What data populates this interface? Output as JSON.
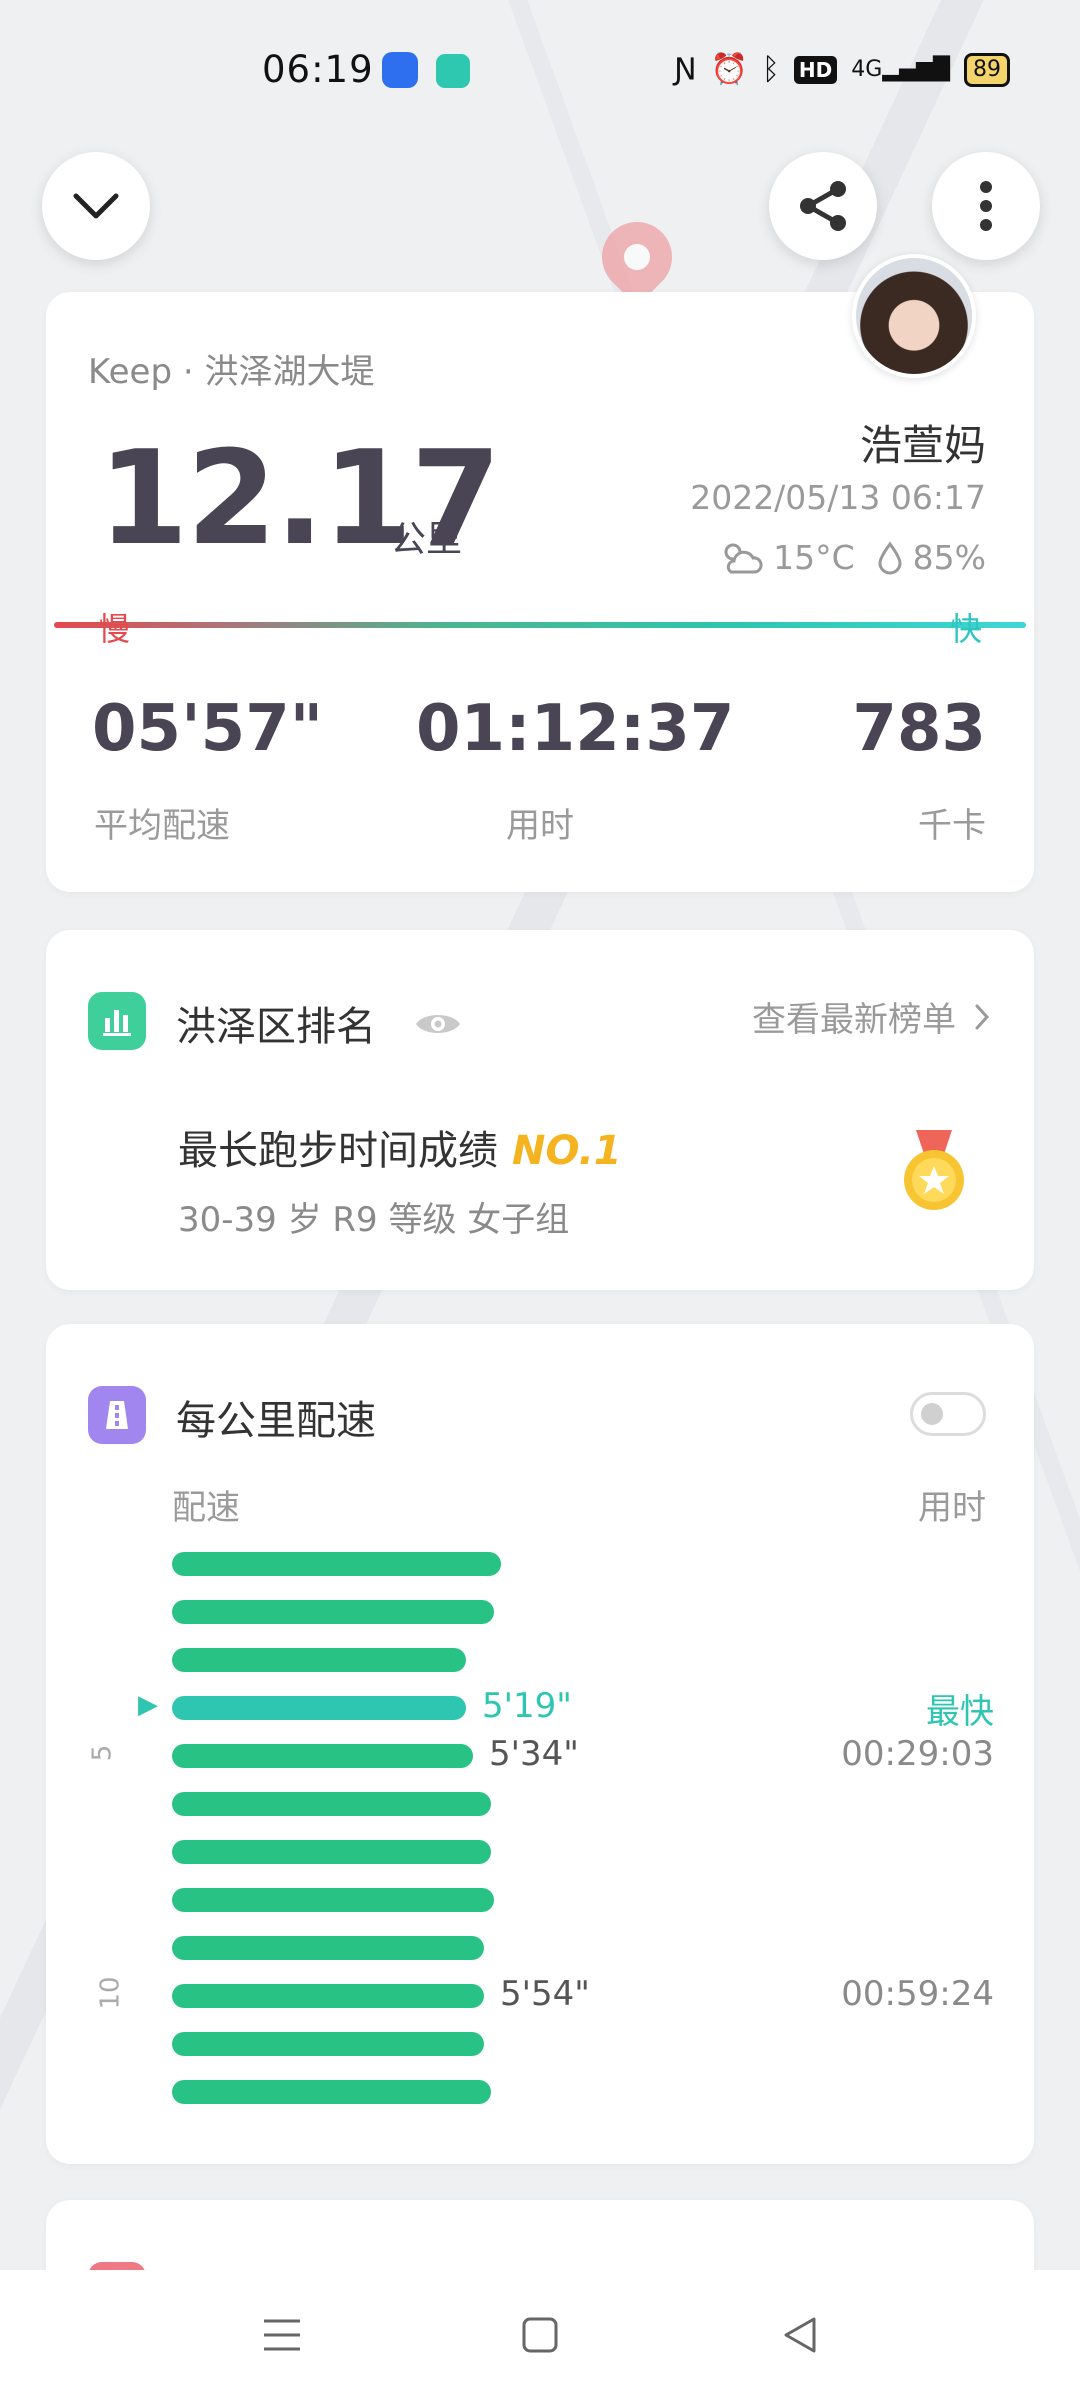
{
  "status_bar": {
    "time": "06:19",
    "battery": "89",
    "network": "4G",
    "hd": "HD"
  },
  "summary": {
    "source": "Keep · 洪泽湖大堤",
    "distance": "12.17",
    "distance_unit": "公里",
    "username": "浩萱妈",
    "datetime": "2022/05/13 06:17",
    "temperature": "15°C",
    "humidity": "85%",
    "slow_label": "慢",
    "fast_label": "快",
    "stats": [
      {
        "value": "05'57\"",
        "label": "平均配速"
      },
      {
        "value": "01:12:37",
        "label": "用时"
      },
      {
        "value": "783",
        "label": "千卡"
      }
    ]
  },
  "ranking": {
    "title": "洪泽区排名",
    "link": "查看最新榜单",
    "achievement": "最长跑步时间成绩",
    "rank": "NO.1",
    "group": "30-39 岁 R9 等级 女子组"
  },
  "pace": {
    "title": "每公里配速",
    "col_pace": "配速",
    "col_time": "用时",
    "fastest_label": "最快",
    "km_ticks": [
      "5",
      "10"
    ],
    "splits": [
      {
        "km": 1,
        "fill": 0.94
      },
      {
        "km": 2,
        "fill": 0.92
      },
      {
        "km": 3,
        "fill": 0.84
      },
      {
        "km": 4,
        "fill": 0.84,
        "pace": "5'19\"",
        "fastest": true
      },
      {
        "km": 5,
        "fill": 0.86,
        "pace": "5'34\"",
        "time": "00:29:03"
      },
      {
        "km": 6,
        "fill": 0.91
      },
      {
        "km": 7,
        "fill": 0.91
      },
      {
        "km": 8,
        "fill": 0.92
      },
      {
        "km": 9,
        "fill": 0.89
      },
      {
        "km": 10,
        "fill": 0.89,
        "pace": "5'54\"",
        "time": "00:59:24"
      },
      {
        "km": 11,
        "fill": 0.89
      },
      {
        "km": 12,
        "fill": 0.91
      }
    ]
  },
  "icons": {
    "collapse": "chevron-down-icon",
    "share": "share-icon",
    "more": "more-vertical-icon"
  },
  "colors": {
    "accent": "#2ec6b0",
    "bar": "#29c285",
    "slow": "#e5484d",
    "rank": "#f5b41f"
  }
}
